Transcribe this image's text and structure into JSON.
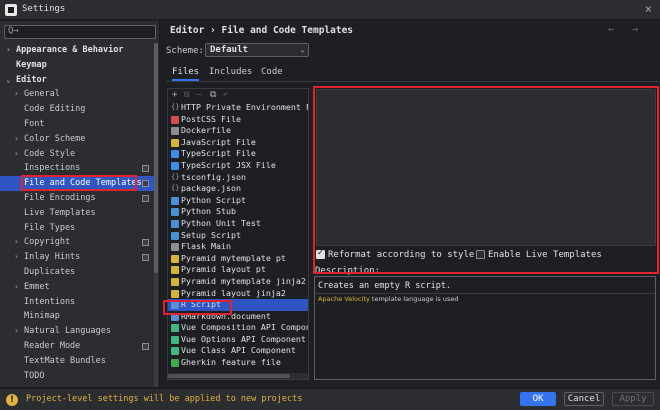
{
  "window": {
    "title": "Settings",
    "close_glyph": "×"
  },
  "sidebar": {
    "search_placeholder": "",
    "search_glyph": "Q→",
    "items": [
      {
        "label": "Appearance & Behavior",
        "arrow": "›",
        "level": 0,
        "bold": true
      },
      {
        "label": "Keymap",
        "arrow": "",
        "level": 0,
        "bold": true
      },
      {
        "label": "Editor",
        "arrow": "⌄",
        "level": 0,
        "bold": true
      },
      {
        "label": "General",
        "arrow": "›",
        "level": 1
      },
      {
        "label": "Code Editing",
        "arrow": "",
        "level": 1
      },
      {
        "label": "Font",
        "arrow": "",
        "level": 1
      },
      {
        "label": "Color Scheme",
        "arrow": "›",
        "level": 1
      },
      {
        "label": "Code Style",
        "arrow": "›",
        "level": 1
      },
      {
        "label": "Inspections",
        "arrow": "",
        "level": 1,
        "badge": true
      },
      {
        "label": "File and Code Templates",
        "arrow": "",
        "level": 1,
        "selected": true,
        "badge": true
      },
      {
        "label": "File Encodings",
        "arrow": "",
        "level": 1,
        "badge": true
      },
      {
        "label": "Live Templates",
        "arrow": "",
        "level": 1
      },
      {
        "label": "File Types",
        "arrow": "",
        "level": 1
      },
      {
        "label": "Copyright",
        "arrow": "›",
        "level": 1,
        "badge": true
      },
      {
        "label": "Inlay Hints",
        "arrow": "›",
        "level": 1,
        "badge": true
      },
      {
        "label": "Duplicates",
        "arrow": "",
        "level": 1
      },
      {
        "label": "Emmet",
        "arrow": "›",
        "level": 1
      },
      {
        "label": "Intentions",
        "arrow": "",
        "level": 1
      },
      {
        "label": "Minimap",
        "arrow": "",
        "level": 1
      },
      {
        "label": "Natural Languages",
        "arrow": "›",
        "level": 1
      },
      {
        "label": "Reader Mode",
        "arrow": "",
        "level": 1,
        "badge": true
      },
      {
        "label": "TextMate Bundles",
        "arrow": "",
        "level": 1
      },
      {
        "label": "TODO",
        "arrow": "",
        "level": 1
      }
    ]
  },
  "main": {
    "breadcrumb": "Editor › File and Code Templates",
    "nav_arrows": "← →",
    "scheme_label": "Scheme:",
    "scheme_value": "Default",
    "tabs": [
      {
        "label": "Files",
        "active": true
      },
      {
        "label": "Includes"
      },
      {
        "label": "Code"
      }
    ],
    "toolbar": {
      "add": "+",
      "remove": "⊟",
      "remove_dim": "—",
      "copy": "⧉",
      "reset": "↶"
    },
    "files": [
      {
        "label": "HTTP Private Environment File",
        "icon_color": "#6f7278",
        "icon": "{}"
      },
      {
        "label": "PostCSS File",
        "icon_color": "#d24d57"
      },
      {
        "label": "Dockerfile",
        "icon_color": "#8a8d93"
      },
      {
        "label": "JavaScript File",
        "icon_color": "#d6b43a"
      },
      {
        "label": "TypeScript File",
        "icon_color": "#3d8ee8"
      },
      {
        "label": "TypeScript JSX File",
        "icon_color": "#3d8ee8"
      },
      {
        "label": "tsconfig.json",
        "icon_color": "#6f7278",
        "icon": "{}"
      },
      {
        "label": "package.json",
        "icon_color": "#6f7278",
        "icon": "{}"
      },
      {
        "label": "Python Script",
        "icon_color": "#4a90d9"
      },
      {
        "label": "Python Stub",
        "icon_color": "#4a90d9"
      },
      {
        "label": "Python Unit Test",
        "icon_color": "#4a90d9"
      },
      {
        "label": "Setup Script",
        "icon_color": "#4a90d9"
      },
      {
        "label": "Flask Main",
        "icon_color": "#8a8d93"
      },
      {
        "label": "Pyramid mytemplate pt",
        "icon_color": "#d6b43a"
      },
      {
        "label": "Pyramid layout pt",
        "icon_color": "#d6b43a"
      },
      {
        "label": "Pyramid mytemplate jinja2",
        "icon_color": "#d6b43a"
      },
      {
        "label": "Pyramid layout jinja2",
        "icon_color": "#d6b43a"
      },
      {
        "label": "R Script",
        "icon_color": "#5b8fd4",
        "selected": true
      },
      {
        "label": "RMarkdown.document",
        "icon_color": "#5b8fd4"
      },
      {
        "label": "Vue Composition API Component",
        "icon_color": "#41b883"
      },
      {
        "label": "Vue Options API Component",
        "icon_color": "#41b883"
      },
      {
        "label": "Vue Class API Component",
        "icon_color": "#41b883"
      },
      {
        "label": "Gherkin feature file",
        "icon_color": "#3fa94b"
      }
    ],
    "reformat_label": "Reformat according to style",
    "reformat_checked": true,
    "live_label": "Enable Live Templates",
    "live_checked": false,
    "description_label": "Description:",
    "description_text": "Creates an empty R script.",
    "desc_link": "Apache Velocity",
    "desc_rest": " template language is used"
  },
  "footer": {
    "warning_glyph": "!",
    "warning": "Project-level settings will be applied to new projects",
    "ok": "OK",
    "cancel": "Cancel",
    "apply": "Apply"
  },
  "colors": {
    "accent": "#3574f0",
    "selection": "#2e55c2",
    "highlight": "#e0232f",
    "warning": "#e3b341"
  }
}
